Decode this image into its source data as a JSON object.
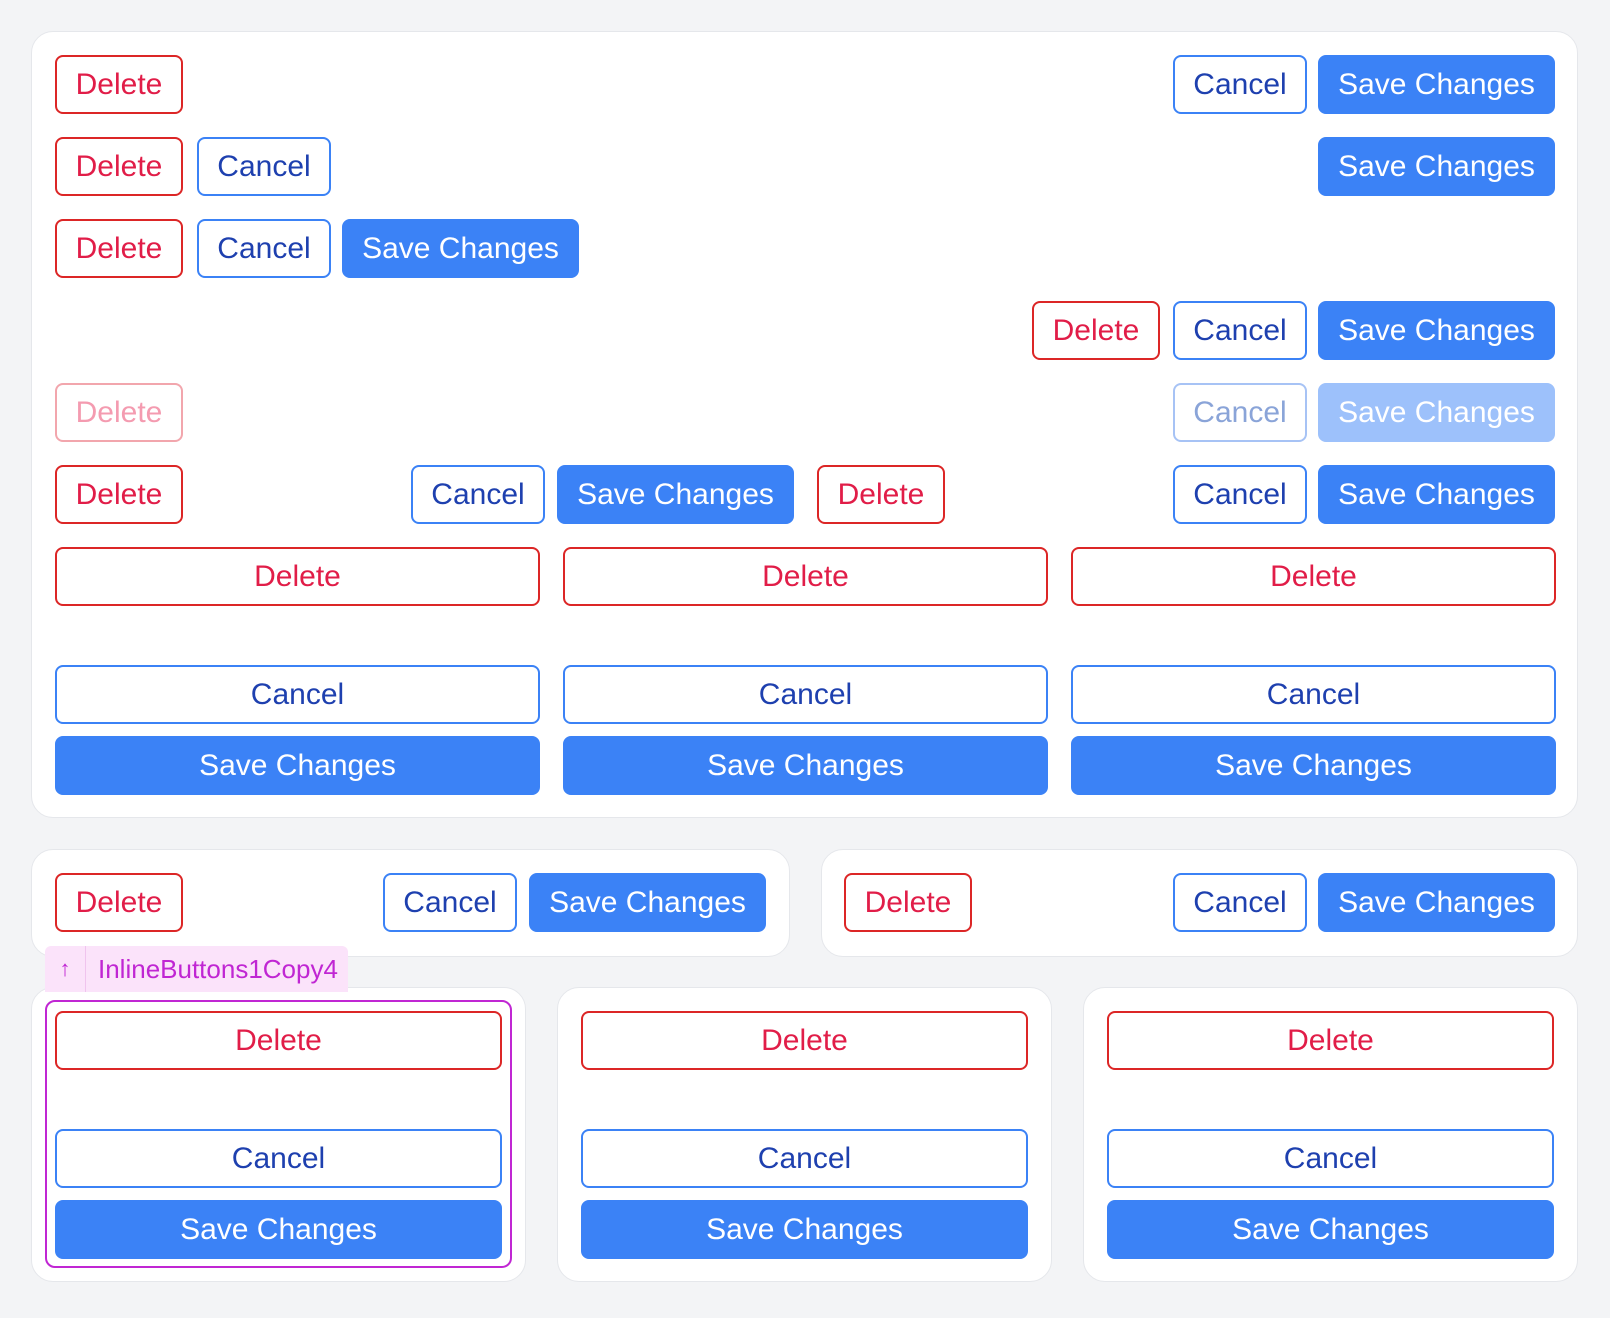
{
  "labels": {
    "delete": "Delete",
    "cancel": "Cancel",
    "save": "Save Changes"
  },
  "debug_overlay": {
    "arrow_icon": "arrow-up-icon",
    "label": "InlineButtons1Copy4"
  },
  "colors": {
    "page_background": "#f3f4f6",
    "card_background": "#ffffff",
    "delete_border": "#dc2626",
    "delete_text": "#e11d48",
    "cancel_border": "#3b82f6",
    "cancel_text": "#1e40af",
    "save_background": "#3b82f6",
    "save_text": "#ffffff",
    "overlay_accent": "#c026d3",
    "overlay_tag_background": "#fbe3fa"
  },
  "states": {
    "row5_buttons": "disabled"
  }
}
